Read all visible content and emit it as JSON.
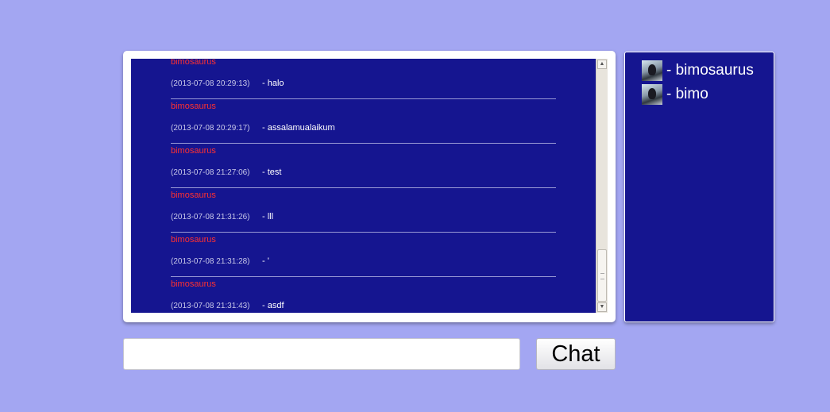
{
  "chat": {
    "messages": [
      {
        "user": "bimosaurus",
        "time": "(2013-07-08 20:29:13)",
        "text": "- halo"
      },
      {
        "user": "bimosaurus",
        "time": "(2013-07-08 20:29:17)",
        "text": "- assalamualaikum"
      },
      {
        "user": "bimosaurus",
        "time": "(2013-07-08 21:27:06)",
        "text": "- test"
      },
      {
        "user": "bimosaurus",
        "time": "(2013-07-08 21:31:26)",
        "text": "- lll"
      },
      {
        "user": "bimosaurus",
        "time": "(2013-07-08 21:31:28)",
        "text": "- '"
      },
      {
        "user": "bimosaurus",
        "time": "(2013-07-08 21:31:43)",
        "text": "- asdf"
      }
    ]
  },
  "users": {
    "items": [
      {
        "name": "- bimosaurus"
      },
      {
        "name": "- bimo"
      }
    ]
  },
  "composer": {
    "input_value": "",
    "button_label": "Chat"
  },
  "colors": {
    "page_background": "#a3a6f2",
    "panel_background": "#151590",
    "username": "#ff3030"
  }
}
